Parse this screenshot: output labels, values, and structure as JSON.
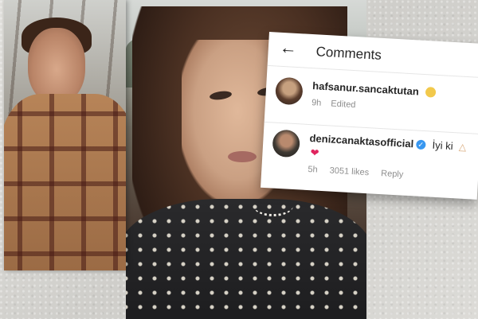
{
  "comments_panel": {
    "title": "Comments",
    "back_icon": "arrow-left-icon",
    "comments": [
      {
        "username": "hafsanur.sancaktutan",
        "text": "",
        "emoji": "smile-emoji-icon",
        "time": "9h",
        "status": "Edited",
        "verified": false
      },
      {
        "username": "denizcanaktasofficial",
        "text": "İyi ki",
        "emoji": [
          "cake-emoji-icon",
          "heart-emoji-icon"
        ],
        "time": "5h",
        "likes": "3051 likes",
        "reply_label": "Reply",
        "verified": true
      }
    ]
  },
  "colors": {
    "verified_badge": "#3897f0",
    "heart": "#e0245e",
    "meta_text": "#8e8e8e"
  }
}
